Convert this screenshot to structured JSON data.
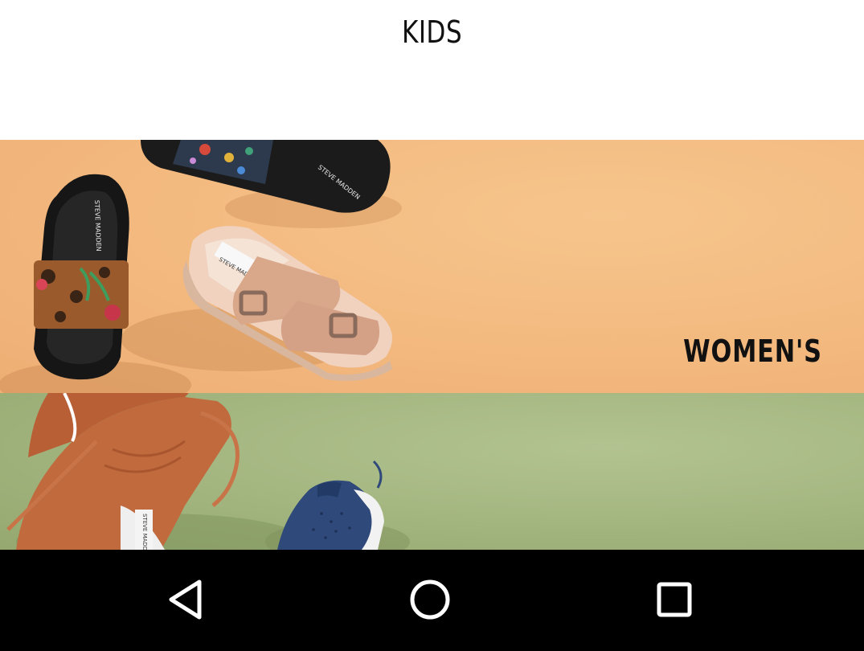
{
  "header": {
    "category_title": "KIDS"
  },
  "banners": [
    {
      "label": "WOMEN'S",
      "background": "#f3b97f",
      "brand_print": "STEVE MADDEN"
    },
    {
      "label": "",
      "background": "#a3b57f",
      "brand_print": "STEVE MADDEN"
    }
  ],
  "navigation_bar": {
    "background": "#000000",
    "icons": [
      "back-icon",
      "home-icon",
      "recents-icon"
    ]
  }
}
